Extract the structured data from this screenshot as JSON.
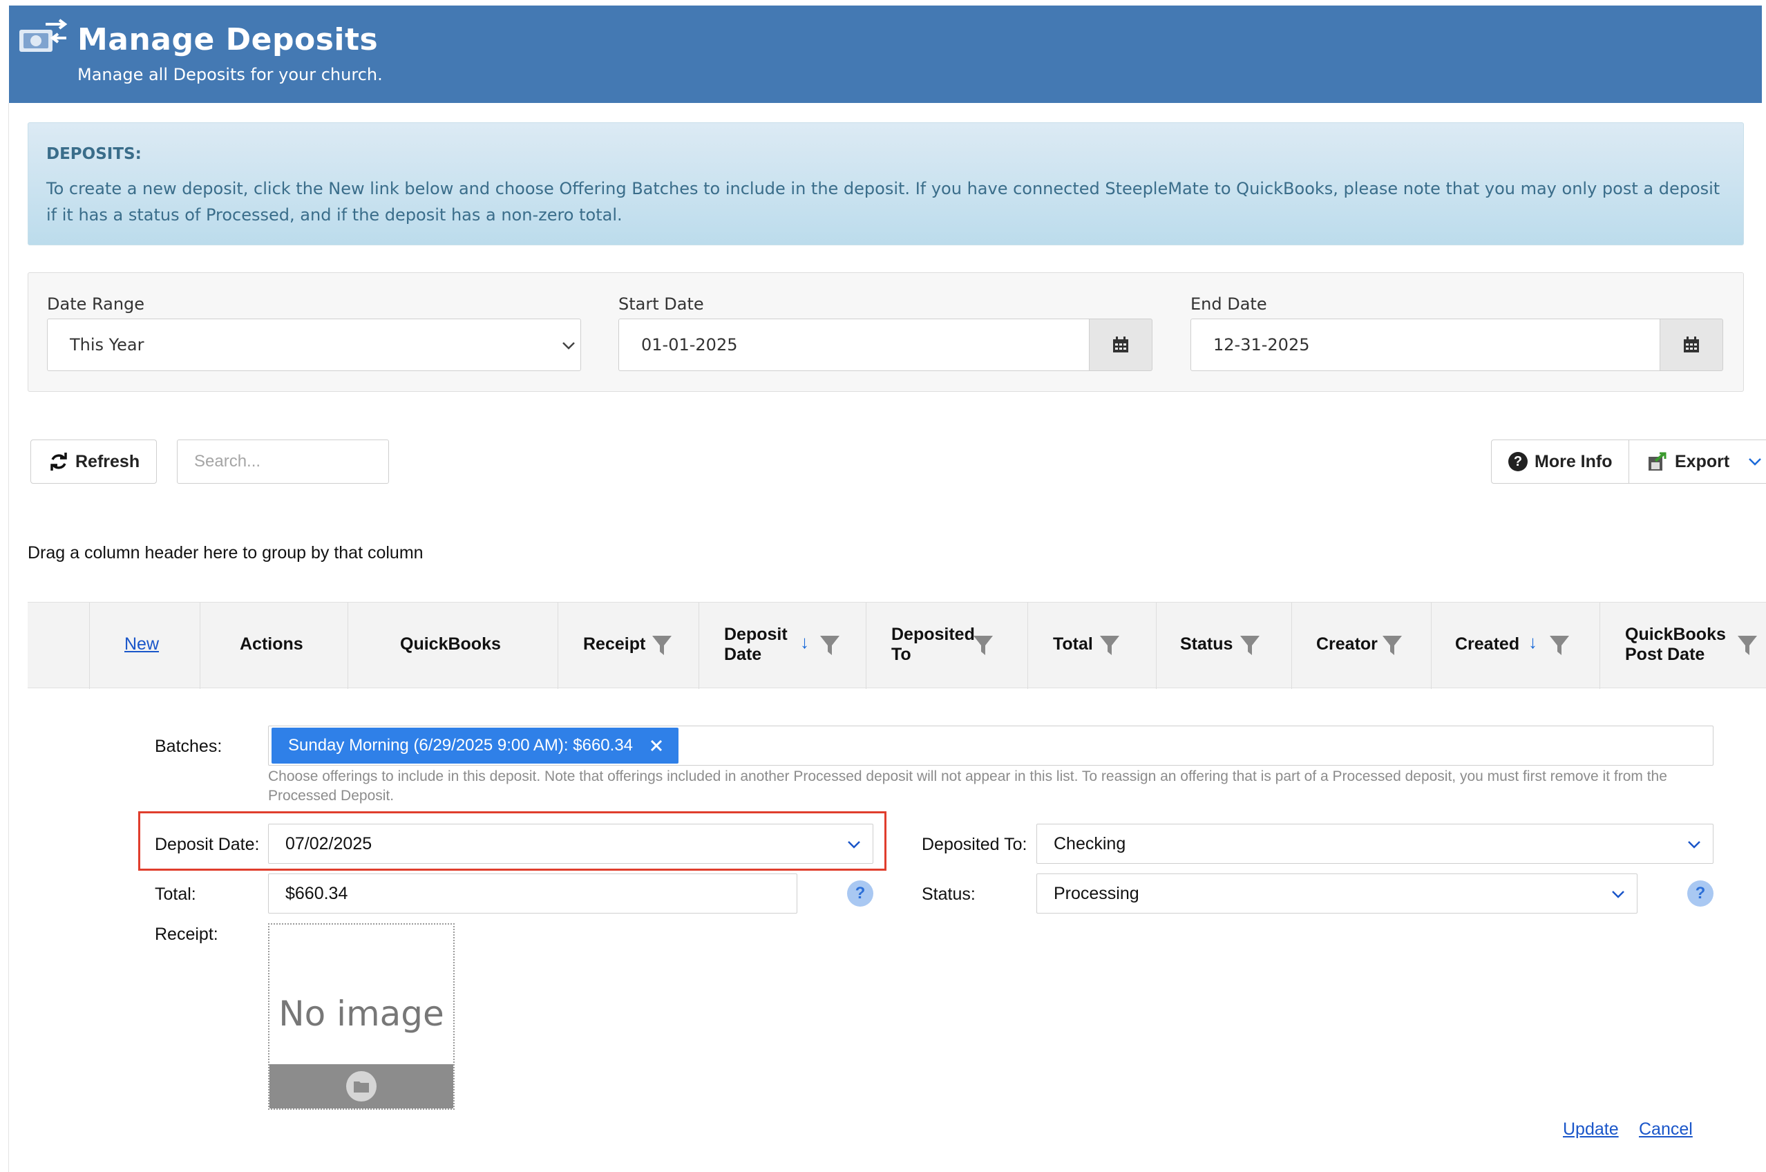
{
  "header": {
    "title": "Manage Deposits",
    "subtitle": "Manage all Deposits for your church."
  },
  "notice": {
    "title": "DEPOSITS:",
    "text": "To create a new deposit, click the New link below and choose Offering Batches to include in the deposit. If you have connected SteepleMate to QuickBooks, please note that you may only post a deposit if it has a status of Processed, and if the deposit has a non-zero total."
  },
  "filters": {
    "date_range": {
      "label": "Date Range",
      "value": "This Year"
    },
    "start_date": {
      "label": "Start Date",
      "value": "01-01-2025"
    },
    "end_date": {
      "label": "End Date",
      "value": "12-31-2025"
    }
  },
  "toolbar": {
    "refresh_label": "Refresh",
    "search_placeholder": "Search...",
    "more_info_label": "More Info",
    "export_label": "Export"
  },
  "grid": {
    "group_hint": "Drag a column header here to group by that column",
    "new_label": "New",
    "columns": {
      "actions": "Actions",
      "quickbooks": "QuickBooks",
      "receipt": "Receipt",
      "deposit_date_1": "Deposit",
      "deposit_date_2": "Date",
      "deposited_to_1": "Deposited",
      "deposited_to_2": "To",
      "total": "Total",
      "status": "Status",
      "creator": "Creator",
      "created": "Created",
      "qb_post_date_1": "QuickBooks",
      "qb_post_date_2": "Post Date"
    },
    "sort_arrow": "↓"
  },
  "edit_form": {
    "batches_label": "Batches:",
    "batch_tag": "Sunday Morning (6/29/2025 9:00 AM): $660.34",
    "batches_help": "Choose offerings to include in this deposit. Note that offerings included in another Processed deposit will not appear in this list. To reassign an offering that is part of a Processed deposit, you must first remove it from the Processed Deposit.",
    "deposit_date_label": "Deposit Date:",
    "deposit_date_value": "07/02/2025",
    "deposited_to_label": "Deposited To:",
    "deposited_to_value": "Checking",
    "total_label": "Total:",
    "total_value": "$660.34",
    "status_label": "Status:",
    "status_value": "Processing",
    "receipt_label": "Receipt:",
    "no_image_text": "No image",
    "help_glyph": "?",
    "update_label": "Update",
    "cancel_label": "Cancel"
  },
  "colors": {
    "header_bg": "#4479b3",
    "link": "#1a56c9",
    "tag_bg": "#2f80e8",
    "highlight": "#e03e2d"
  }
}
